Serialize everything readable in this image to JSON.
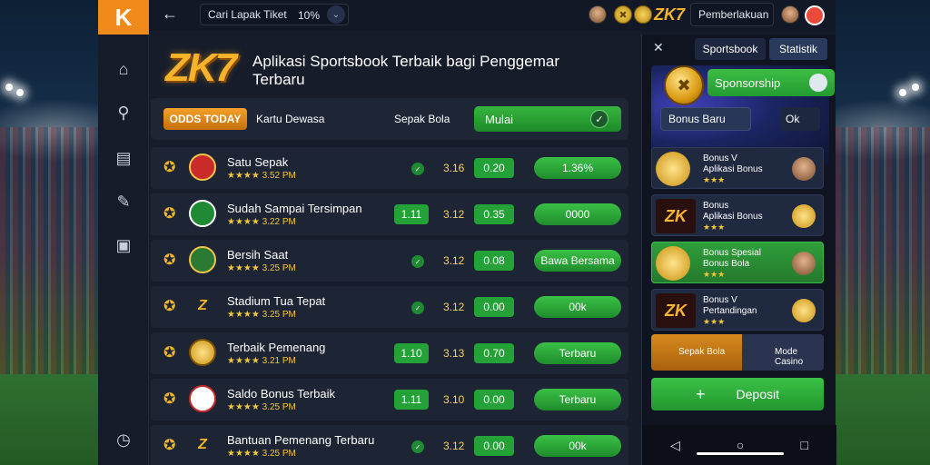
{
  "topbar": {
    "search_value": "Cari Lapak Tiket",
    "zoom": "10%",
    "brand": "ZK7",
    "username": "Pemberlakuan"
  },
  "hero": {
    "logo": "ZK7",
    "title": "Aplikasi Sportsbook Terbaik bagi Penggemar Terbaru"
  },
  "filters": {
    "pill": "ODDS TODAY",
    "label1": "Kartu Dewasa",
    "label2": "Sepak Bola",
    "go": "Mulai"
  },
  "rows": [
    {
      "name": "Satu Sepak",
      "sub": "★★★★ 3.52 PM",
      "odd1": "",
      "odd2": "3.16",
      "odd3": "0.20",
      "action": "1.36%",
      "badge": "shield"
    },
    {
      "name": "Sudah Sampai Tersimpan",
      "sub": "★★★★ 3.22 PM",
      "odd1": "1.11",
      "odd2": "3.12",
      "odd3": "0.35",
      "action": "0000",
      "badge": "ball"
    },
    {
      "name": "Bersih Saat",
      "sub": "★★★★ 3.25 PM",
      "odd1": "",
      "odd2": "3.12",
      "odd3": "0.08",
      "action": "Bawa Bersama",
      "badge": "shirt"
    },
    {
      "name": "Stadium Tua Tepat",
      "sub": "★★★★ 3.25 PM",
      "odd1": "",
      "odd2": "3.12",
      "odd3": "0.00",
      "action": "00k",
      "badge": "zk"
    },
    {
      "name": "Terbaik Pemenang",
      "sub": "★★★★ 3.21 PM",
      "odd1": "1.10",
      "odd2": "3.13",
      "odd3": "0.70",
      "action": "Terbaru",
      "badge": "coin"
    },
    {
      "name": "Saldo Bonus Terbaik",
      "sub": "★★★★ 3.25 PM",
      "odd1": "1.11",
      "odd2": "3.10",
      "odd3": "0.00",
      "action": "Terbaru",
      "badge": "shirt2"
    },
    {
      "name": "Bantuan Pemenang Terbaru",
      "sub": "★★★★ 3.25 PM",
      "odd1": "",
      "odd2": "3.12",
      "odd3": "0.00",
      "action": "00k",
      "badge": "zk"
    }
  ],
  "right": {
    "tab1": "Sportsbook",
    "tab2": "Statistik",
    "green": "Sponsorship",
    "btn": "Bonus Baru",
    "mini": "Ok",
    "cards": [
      {
        "t1": "Bonus V",
        "t2": "Aplikasi Bonus",
        "t3": "★★★",
        "thumb": "coin"
      },
      {
        "t1": "Bonus",
        "t2": "Aplikasi Bonus",
        "t3": "★★★",
        "thumb": "zk"
      },
      {
        "t1": "Bonus Spesial",
        "t2": "Bonus Bola",
        "t3": "★★★",
        "thumb": "coin"
      },
      {
        "t1": "Bonus V",
        "t2": "Pertandingan",
        "t3": "★★★",
        "thumb": "zk"
      }
    ],
    "split_left": "Sepak Bola",
    "split_right": "Mode Casino",
    "deposit": "Deposit"
  }
}
